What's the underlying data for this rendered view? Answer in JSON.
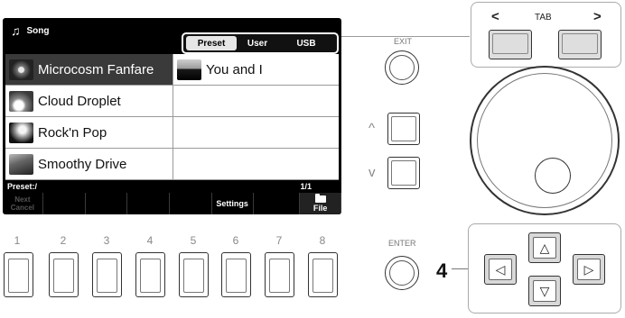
{
  "screen": {
    "title": "Song",
    "tabs": [
      "Preset",
      "User",
      "USB"
    ],
    "active_tab": "Preset",
    "songs": [
      {
        "label": "Microcosm Fanfare",
        "selected": true
      },
      {
        "label": "You and I"
      },
      {
        "label": "Cloud Droplet"
      },
      {
        "label": "Rock'n Pop"
      },
      {
        "label": "Smoothy Drive"
      }
    ],
    "path": "Preset:/",
    "page": "1/1",
    "soft_buttons": {
      "next_line1": "Next",
      "next_line2": "Cancel",
      "settings": "Settings",
      "file": "File"
    }
  },
  "panel": {
    "tab_left": "<",
    "tab_label": "TAB",
    "tab_right": ">",
    "exit_label": "EXIT",
    "up_arrow": "^",
    "down_arrow": "v",
    "enter_label": "ENTER",
    "step_number": "4",
    "cursor_up": "△",
    "cursor_down": "▽",
    "cursor_left": "◁",
    "cursor_right": "▷",
    "button_numbers": [
      "1",
      "2",
      "3",
      "4",
      "5",
      "6",
      "7",
      "8"
    ]
  }
}
